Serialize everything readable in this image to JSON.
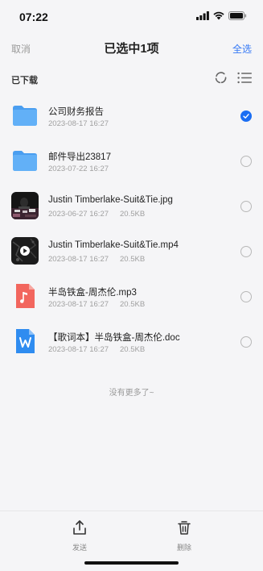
{
  "status_bar": {
    "time": "07:22"
  },
  "nav": {
    "cancel": "取消",
    "title": "已选中1项",
    "select_all": "全选"
  },
  "section": {
    "title": "已下载"
  },
  "files": [
    {
      "name": "公司财务报告",
      "date": "2023-08-17 16:27",
      "size": "",
      "type": "folder",
      "checked": true
    },
    {
      "name": "邮件导出23817",
      "date": "2023-07-22 16:27",
      "size": "",
      "type": "folder",
      "checked": false
    },
    {
      "name": "Justin Timberlake-Suit&Tie.jpg",
      "date": "2023-06-27 16:27",
      "size": "20.5KB",
      "type": "image",
      "checked": false
    },
    {
      "name": "Justin Timberlake-Suit&Tie.mp4",
      "date": "2023-08-17 16:27",
      "size": "20.5KB",
      "type": "video",
      "checked": false
    },
    {
      "name": "半岛铁盒-周杰伦.mp3",
      "date": "2023-08-17 16:27",
      "size": "20.5KB",
      "type": "audio",
      "checked": false
    },
    {
      "name": "【歌词本】半岛铁盒-周杰伦.doc",
      "date": "2023-08-17 16:27",
      "size": "20.5KB",
      "type": "doc",
      "checked": false
    }
  ],
  "end_hint": "没有更多了~",
  "bottom_bar": {
    "send_label": "发送",
    "delete_label": "删除"
  },
  "colors": {
    "accent": "#1b6ef3",
    "folder": "#58a9f5",
    "audio": "#f2665e",
    "doc": "#2f8cf0"
  }
}
